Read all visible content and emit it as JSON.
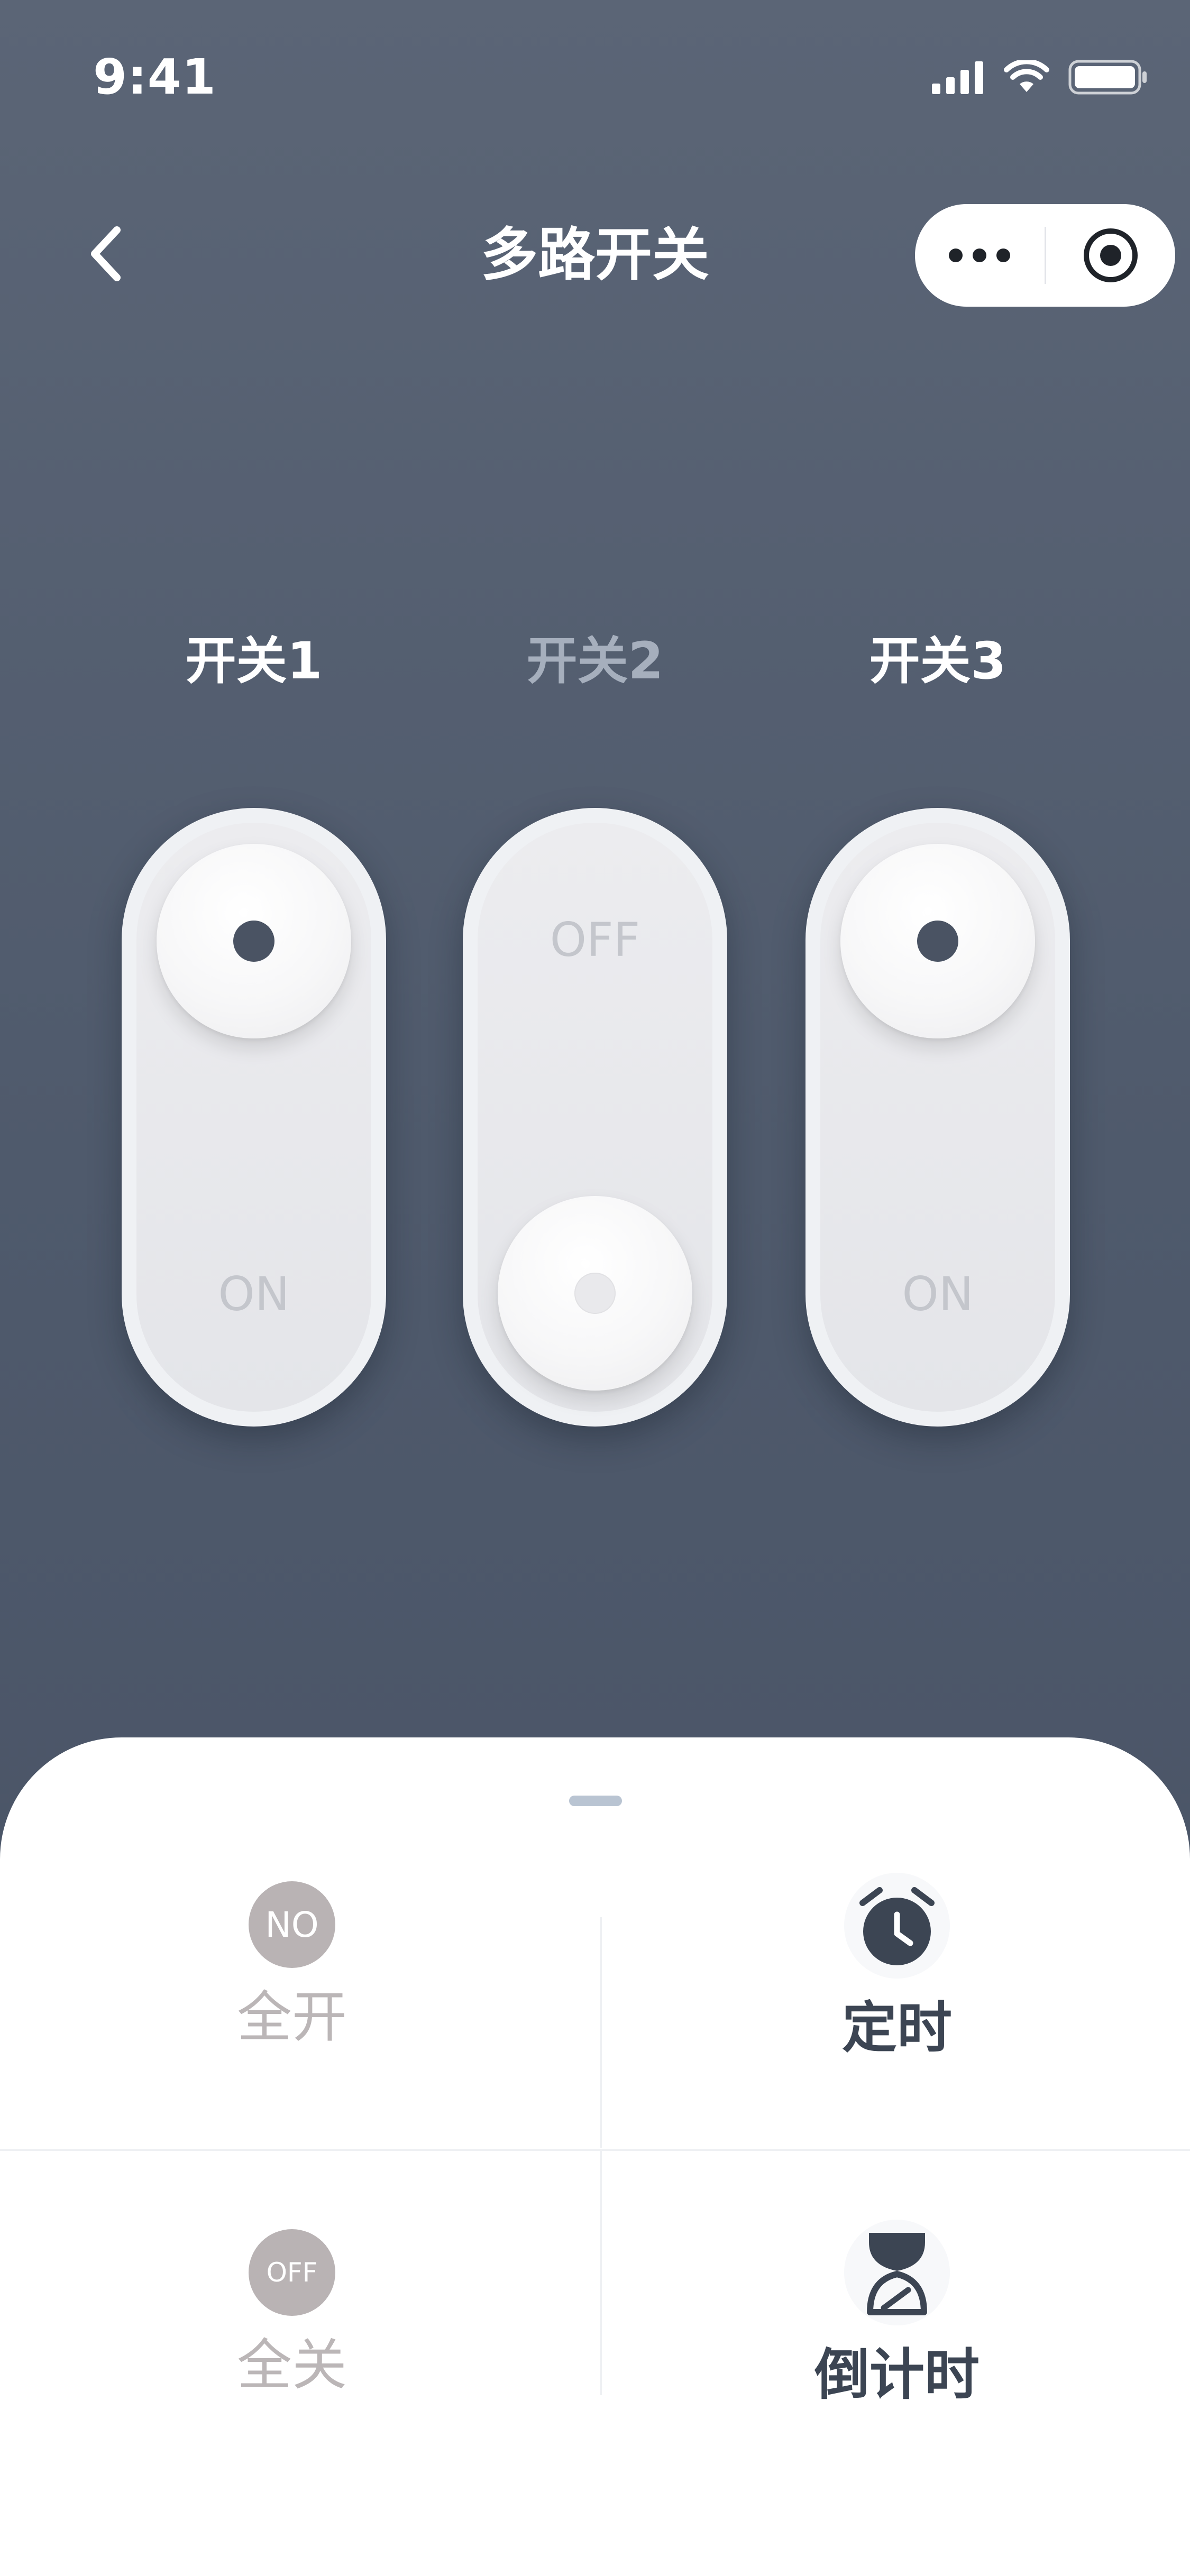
{
  "status_bar": {
    "time": "9:41"
  },
  "nav": {
    "title": "多路开关",
    "back_icon": "chevron-left-icon",
    "more_icon": "more-dots-icon",
    "close_icon": "target-circle-icon"
  },
  "switches": [
    {
      "label": "开关1",
      "state_text": "ON",
      "state": "on"
    },
    {
      "label": "开关2",
      "state_text": "OFF",
      "state": "off"
    },
    {
      "label": "开关3",
      "state_text": "ON",
      "state": "on"
    }
  ],
  "actions": {
    "all_on": {
      "badge": "NO",
      "label": "全开"
    },
    "timer": {
      "label": "定时",
      "icon": "alarm-clock-icon"
    },
    "all_off": {
      "badge": "OFF",
      "label": "全关"
    },
    "countdown": {
      "label": "倒计时",
      "icon": "hourglass-icon"
    }
  },
  "colors": {
    "background_top": "#5b6576",
    "background_bottom": "#475164",
    "knob_dot": "#4a5363",
    "badge": "#b9b3b4",
    "accent_dark": "#3c4553"
  }
}
